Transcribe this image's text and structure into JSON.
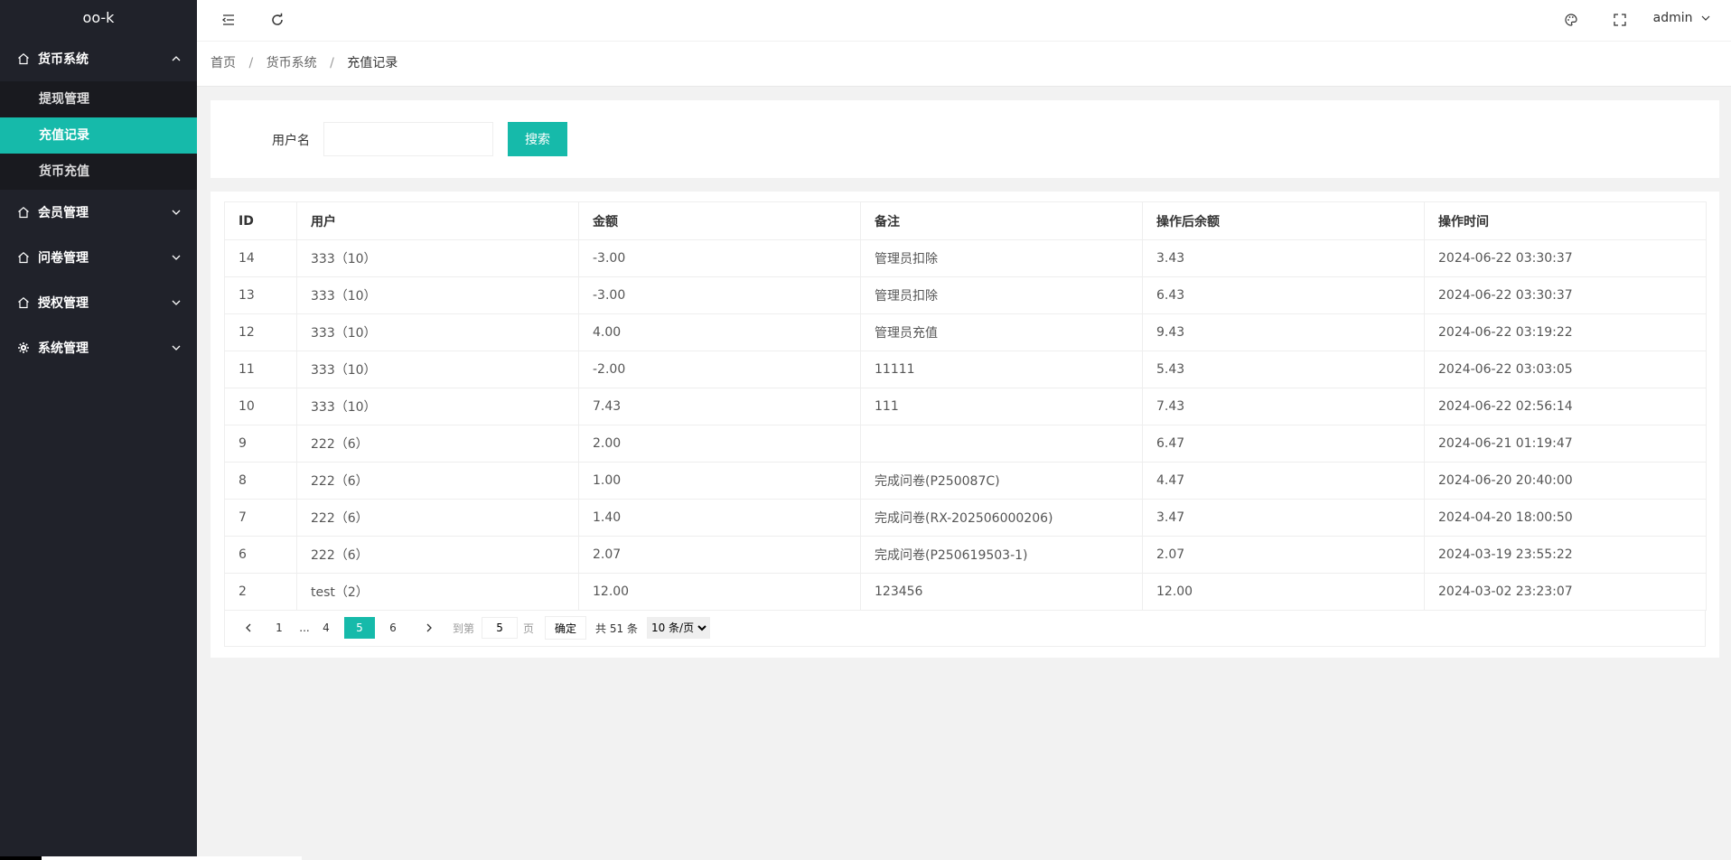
{
  "app": {
    "title": "oo-k"
  },
  "sidebar": {
    "groups": [
      {
        "label": "货币系统",
        "icon": "home-icon",
        "expanded": true,
        "items": [
          {
            "label": "提现管理",
            "active": false
          },
          {
            "label": "充值记录",
            "active": true
          },
          {
            "label": "货币充值",
            "active": false
          }
        ]
      },
      {
        "label": "会员管理",
        "icon": "home-icon",
        "expanded": false
      },
      {
        "label": "问卷管理",
        "icon": "home-icon",
        "expanded": false
      },
      {
        "label": "授权管理",
        "icon": "home-icon",
        "expanded": false
      },
      {
        "label": "系统管理",
        "icon": "gear-icon",
        "expanded": false
      }
    ]
  },
  "header": {
    "user": "admin",
    "icons": [
      "menu-fold-icon",
      "refresh-icon",
      "theme-palette-icon",
      "fullscreen-icon"
    ]
  },
  "breadcrumb": {
    "items": [
      "首页",
      "货币系统",
      "充值记录"
    ]
  },
  "search": {
    "label": "用户名",
    "value": "",
    "placeholder": "",
    "button": "搜索"
  },
  "table": {
    "columns": [
      "ID",
      "用户",
      "金额",
      "备注",
      "操作后余额",
      "操作时间"
    ],
    "rows": [
      [
        "14",
        "333（10）",
        "-3.00",
        "管理员扣除",
        "3.43",
        "2024-06-22 03:30:37"
      ],
      [
        "13",
        "333（10）",
        "-3.00",
        "管理员扣除",
        "6.43",
        "2024-06-22 03:30:37"
      ],
      [
        "12",
        "333（10）",
        "4.00",
        "管理员充值",
        "9.43",
        "2024-06-22 03:19:22"
      ],
      [
        "11",
        "333（10）",
        "-2.00",
        "11111",
        "5.43",
        "2024-06-22 03:03:05"
      ],
      [
        "10",
        "333（10）",
        "7.43",
        "111",
        "7.43",
        "2024-06-22 02:56:14"
      ],
      [
        "9",
        "222（6）",
        "2.00",
        "",
        "6.47",
        "2024-06-21 01:19:47"
      ],
      [
        "8",
        "222（6）",
        "1.00",
        "完成问卷(P250087C)",
        "4.47",
        "2024-06-20 20:40:00"
      ],
      [
        "7",
        "222（6）",
        "1.40",
        "完成问卷(RX-202506000206)",
        "3.47",
        "2024-04-20 18:00:50"
      ],
      [
        "6",
        "222（6）",
        "2.07",
        "完成问卷(P250619503-1)",
        "2.07",
        "2024-03-19 23:55:22"
      ],
      [
        "2",
        "test（2）",
        "12.00",
        "123456",
        "12.00",
        "2024-03-02 23:23:07"
      ]
    ]
  },
  "pagination": {
    "pages": [
      "1",
      "...",
      "4",
      "5",
      "6"
    ],
    "current": "5",
    "goto_prefix": "到第",
    "goto_value": "5",
    "goto_suffix": "页",
    "confirm": "确定",
    "total": "共 51 条",
    "page_size": "10 条/页",
    "page_size_options": [
      "10 条/页"
    ]
  }
}
